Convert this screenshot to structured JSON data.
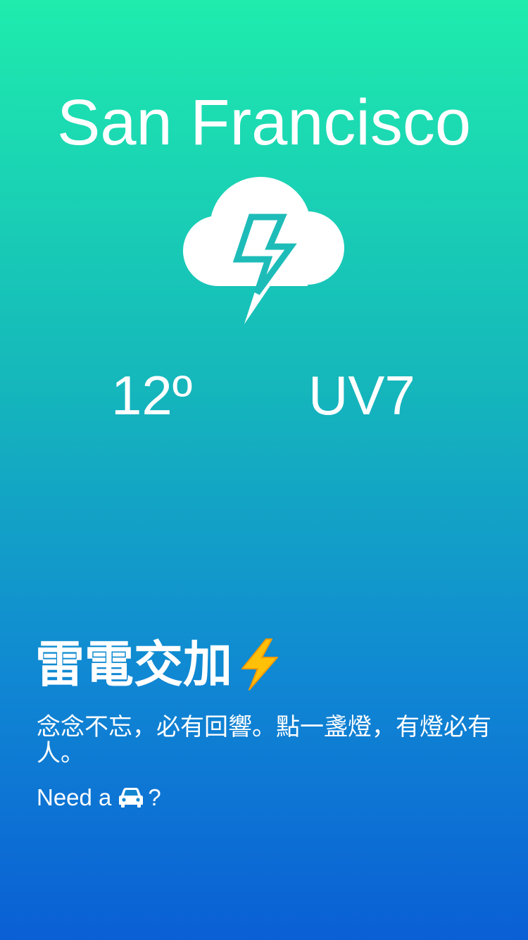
{
  "location": {
    "city": "San Francisco"
  },
  "current": {
    "icon": "thunderstorm-icon",
    "temperature": "12º",
    "uv_index": "UV7"
  },
  "condition": {
    "title": "雷電交加",
    "emoji_icon": "lightning-bolt-icon",
    "description": "念念不忘，必有回響。點一盞燈，有燈必有人。"
  },
  "ride_prompt": {
    "prefix": "Need a",
    "icon": "car-icon",
    "suffix": "?"
  },
  "colors": {
    "gradient_top": "#1fecad",
    "gradient_bottom": "#0a5fd4",
    "text": "#ffffff",
    "bolt_outline": "#1ebcb8",
    "emoji_bolt": "#ffc107"
  }
}
